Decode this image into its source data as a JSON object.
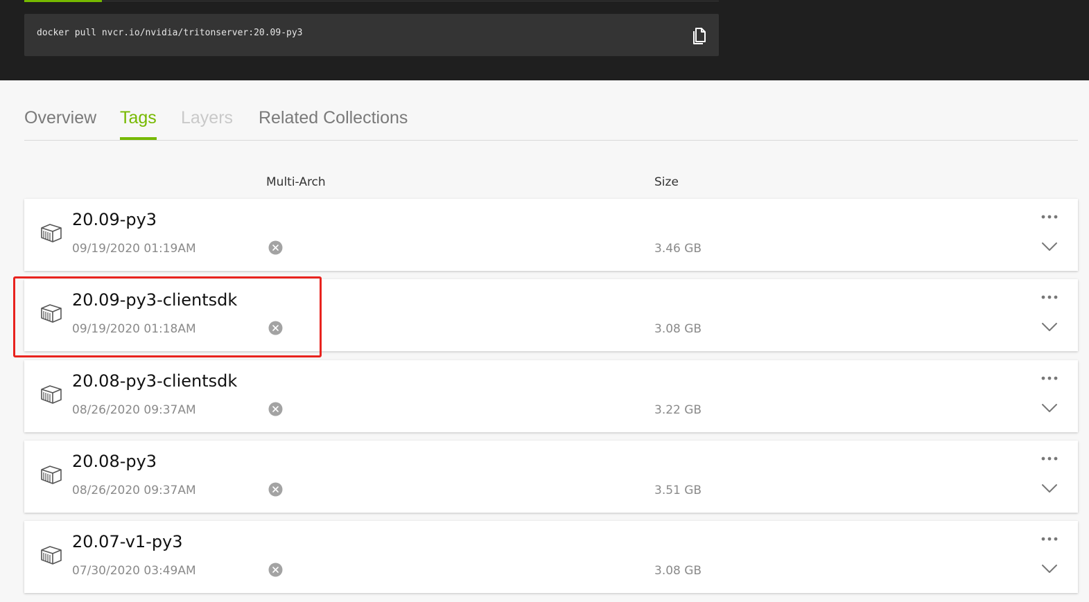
{
  "pull_command": {
    "text": "docker pull nvcr.io/nvidia/tritonserver:20.09-py3",
    "copy_icon": "copy-icon"
  },
  "tabs": [
    {
      "label": "Overview",
      "state": "normal"
    },
    {
      "label": "Tags",
      "state": "active"
    },
    {
      "label": "Layers",
      "state": "disabled"
    },
    {
      "label": "Related Collections",
      "state": "normal"
    }
  ],
  "columns": {
    "multi_arch": "Multi-Arch",
    "size": "Size"
  },
  "tag_rows": [
    {
      "name": "20.09-py3",
      "date": "09/19/2020 01:19AM",
      "multi_arch": "no",
      "size": "3.46 GB"
    },
    {
      "name": "20.09-py3-clientsdk",
      "date": "09/19/2020 01:18AM",
      "multi_arch": "no",
      "size": "3.08 GB",
      "highlighted": true
    },
    {
      "name": "20.08-py3-clientsdk",
      "date": "08/26/2020 09:37AM",
      "multi_arch": "no",
      "size": "3.22 GB"
    },
    {
      "name": "20.08-py3",
      "date": "08/26/2020 09:37AM",
      "multi_arch": "no",
      "size": "3.51 GB"
    },
    {
      "name": "20.07-v1-py3",
      "date": "07/30/2020 03:49AM",
      "multi_arch": "no",
      "size": "3.08 GB"
    }
  ],
  "colors": {
    "accent": "#76b900",
    "highlight_border": "#e8231e",
    "header_background": "#1f1f1f"
  }
}
